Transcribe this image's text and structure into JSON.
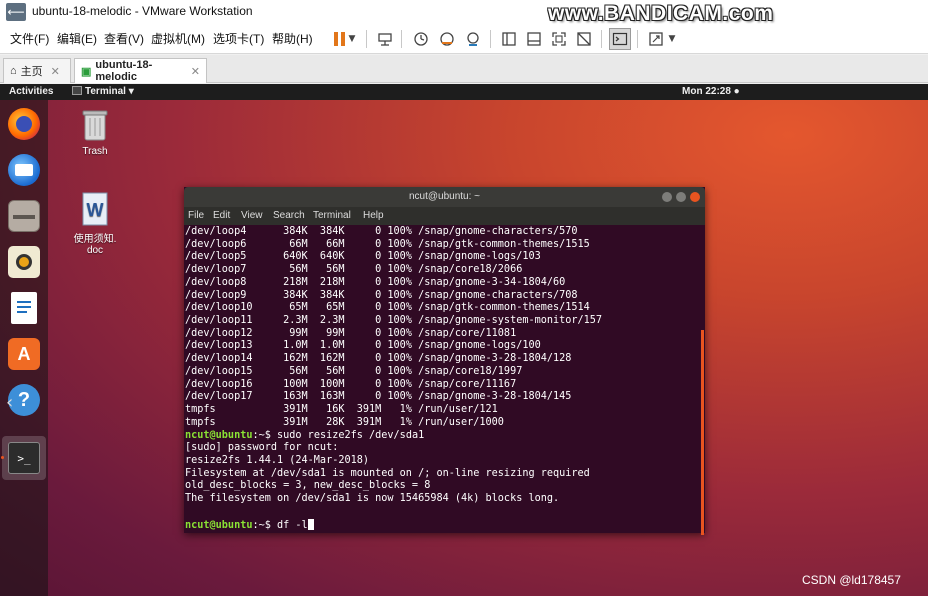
{
  "window": {
    "title": "ubuntu-18-melodic - VMware Workstation",
    "watermark": "www.BANDICAM.com"
  },
  "menubar": {
    "items": [
      "文件(F)",
      "编辑(E)",
      "查看(V)",
      "虚拟机(M)",
      "选项卡(T)",
      "帮助(H)"
    ]
  },
  "toolbar": {
    "icons": [
      "pause-icon",
      "send-ctrl-alt-del-icon",
      "snapshot-icon",
      "revert-snapshot-icon",
      "snapshot-manager-icon",
      "library-icon",
      "thumbnail-icon",
      "fullscreen-icon",
      "unity-icon",
      "console-view-icon",
      "stretch-icon"
    ]
  },
  "tabs": [
    {
      "label": "主页",
      "icon": "home-icon"
    },
    {
      "label": "ubuntu-18-melodic",
      "icon": "vm-icon"
    }
  ],
  "ubuntu": {
    "activities": "Activities",
    "app_menu": "Terminal ▾",
    "clock": "Mon 22:28 ●"
  },
  "desktop_icons": [
    {
      "label": "Trash"
    },
    {
      "label": "使用须知.\ndoc"
    }
  ],
  "terminal": {
    "title": "ncut@ubuntu: ~",
    "menu": [
      "File",
      "Edit",
      "View",
      "Search",
      "Terminal",
      "Help"
    ],
    "lines": [
      {
        "text": "/dev/loop4      384K  384K     0 100% /snap/gnome-characters/570"
      },
      {
        "text": "/dev/loop6       66M   66M     0 100% /snap/gtk-common-themes/1515"
      },
      {
        "text": "/dev/loop5      640K  640K     0 100% /snap/gnome-logs/103"
      },
      {
        "text": "/dev/loop7       56M   56M     0 100% /snap/core18/2066"
      },
      {
        "text": "/dev/loop8      218M  218M     0 100% /snap/gnome-3-34-1804/60"
      },
      {
        "text": "/dev/loop9      384K  384K     0 100% /snap/gnome-characters/708"
      },
      {
        "text": "/dev/loop10      65M   65M     0 100% /snap/gtk-common-themes/1514"
      },
      {
        "text": "/dev/loop11     2.3M  2.3M     0 100% /snap/gnome-system-monitor/157"
      },
      {
        "text": "/dev/loop12      99M   99M     0 100% /snap/core/11081"
      },
      {
        "text": "/dev/loop13     1.0M  1.0M     0 100% /snap/gnome-logs/100"
      },
      {
        "text": "/dev/loop14     162M  162M     0 100% /snap/gnome-3-28-1804/128"
      },
      {
        "text": "/dev/loop15      56M   56M     0 100% /snap/core18/1997"
      },
      {
        "text": "/dev/loop16     100M  100M     0 100% /snap/core/11167"
      },
      {
        "text": "/dev/loop17     163M  163M     0 100% /snap/gnome-3-28-1804/145"
      },
      {
        "text": "tmpfs           391M   16K  391M   1% /run/user/121"
      },
      {
        "text": "tmpfs           391M   28K  391M   1% /run/user/1000"
      },
      {
        "prompt": "ncut@ubuntu",
        "suffix": ":~$ ",
        "text": "sudo resize2fs /dev/sda1"
      },
      {
        "text": "[sudo] password for ncut:"
      },
      {
        "text": "resize2fs 1.44.1 (24-Mar-2018)"
      },
      {
        "text": "Filesystem at /dev/sda1 is mounted on /; on-line resizing required"
      },
      {
        "text": "old_desc_blocks = 3, new_desc_blocks = 8"
      },
      {
        "text": "The filesystem on /dev/sda1 is now 15465984 (4k) blocks long."
      },
      {
        "text": ""
      },
      {
        "prompt": "ncut@ubuntu",
        "suffix": ":~$ ",
        "text": "df -l",
        "cursor": true
      }
    ]
  },
  "footer_watermark": "CSDN @ld178457"
}
